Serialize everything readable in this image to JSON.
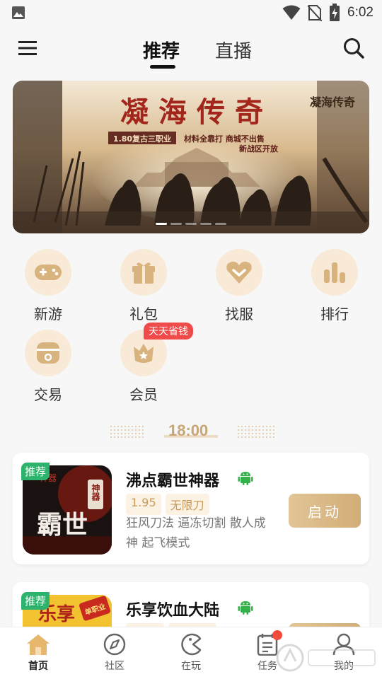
{
  "status_bar": {
    "time": "6:02"
  },
  "top_nav": {
    "tabs": [
      {
        "label": "推荐"
      },
      {
        "label": "直播"
      }
    ]
  },
  "banner": {
    "title_art": "凝海传奇",
    "logo_art": "凝海传奇",
    "slogan_left": "1.80复古三职业",
    "slogan_right_1": "材料全靠打 商城不出售",
    "slogan_right_2": "新战区开放",
    "dots": 5
  },
  "quick_entries": [
    {
      "label": "新游",
      "icon": "gamepad-icon"
    },
    {
      "label": "礼包",
      "icon": "gift-icon"
    },
    {
      "label": "找服",
      "icon": "heart-chevron-icon"
    },
    {
      "label": "排行",
      "icon": "bar-chart-icon"
    },
    {
      "label": "交易",
      "icon": "bag-icon"
    },
    {
      "label": "会员",
      "icon": "crown-badge-icon",
      "badge": "天天省钱"
    }
  ],
  "schedule": {
    "time": "18:00"
  },
  "games": [
    {
      "tag": "推荐",
      "title": "沸点霸世神器",
      "tags": [
        "1.95",
        "无限刀"
      ],
      "desc": "狂风刀法 逼冻切割 散人成神 起飞模式",
      "button": "启动",
      "art": "霸世",
      "art_small": "神器",
      "art_top": "神器"
    },
    {
      "tag": "推荐",
      "title": "乐享饮血大陆",
      "art": "乐享",
      "art_badge": "单职业"
    }
  ],
  "bottom_nav": [
    {
      "label": "首页",
      "icon": "home-icon"
    },
    {
      "label": "社区",
      "icon": "compass-icon"
    },
    {
      "label": "在玩",
      "icon": "pacman-icon"
    },
    {
      "label": "任务",
      "icon": "clipboard-icon"
    },
    {
      "label": "我的",
      "icon": "user-icon"
    }
  ],
  "colors": {
    "accent": "#d1ad78",
    "accent_light": "#f8ead6",
    "recommend_green": "#2db36b",
    "badge_red": "#f04b4b"
  }
}
